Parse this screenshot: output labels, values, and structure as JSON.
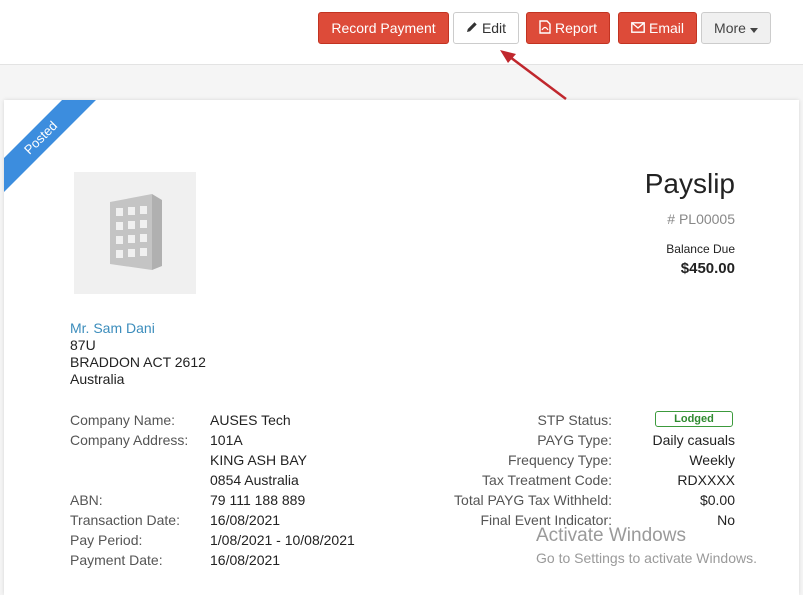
{
  "toolbar": {
    "record_payment": "Record Payment",
    "edit": "Edit",
    "report": "Report",
    "email": "Email",
    "more": "More"
  },
  "payslip": {
    "ribbon": "Posted",
    "title": "Payslip",
    "number": "# PL00005",
    "balance_label": "Balance Due",
    "balance_value": "$450.00"
  },
  "recipient": {
    "name": "Mr. Sam Dani",
    "line1": "87U",
    "line2": "BRADDON ACT 2612",
    "line3": "Australia"
  },
  "details_left": {
    "company_name_label": "Company Name:",
    "company_name": "AUSES Tech",
    "company_address_label": "Company Address:",
    "address1": "101A",
    "address2": "KING ASH BAY",
    "address3": "0854 Australia",
    "abn_label": "ABN:",
    "abn": "79 111 188 889",
    "transaction_date_label": "Transaction Date:",
    "transaction_date": "16/08/2021",
    "pay_period_label": "Pay Period:",
    "pay_period": "1/08/2021 - 10/08/2021",
    "payment_date_label": "Payment Date:",
    "payment_date": "16/08/2021"
  },
  "details_right": {
    "stp_status_label": "STP Status:",
    "stp_status": "Lodged",
    "payg_type_label": "PAYG Type:",
    "payg_type": "Daily casuals",
    "frequency_type_label": "Frequency Type:",
    "frequency_type": "Weekly",
    "tax_treatment_label": "Tax Treatment Code:",
    "tax_treatment": "RDXXXX",
    "total_payg_label": "Total PAYG Tax Withheld:",
    "total_payg": "$0.00",
    "final_event_label": "Final Event Indicator:",
    "final_event": "No"
  },
  "watermark": {
    "line1": "Activate Windows",
    "line2": "Go to Settings to activate Windows."
  },
  "icons": {
    "edit": "pencil-icon",
    "report": "pdf-file-icon",
    "email": "envelope-icon",
    "more": "caret-down-icon",
    "logo": "building-icon",
    "annotation": "red-arrow"
  },
  "colors": {
    "red_button": "#dd4b39",
    "ribbon": "#3c8dde",
    "link": "#3c8dbc",
    "badge_green": "#2f8a2f",
    "arrow": "#c0272d"
  }
}
